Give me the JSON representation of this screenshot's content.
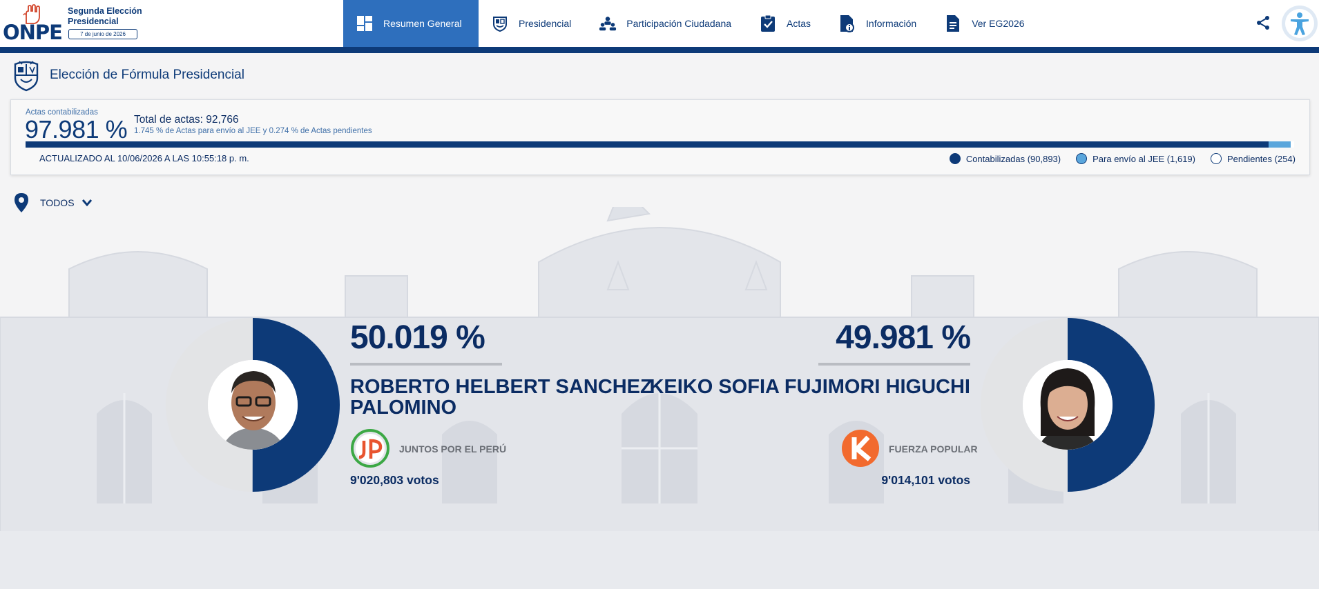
{
  "header": {
    "logo_text": "ONPE",
    "election_title": "Segunda Elección Presidencial",
    "election_date": "7 de junio de 2026",
    "nav": [
      {
        "label": "Resumen General",
        "icon": "dashboard-icon",
        "active": true
      },
      {
        "label": "Presidencial",
        "icon": "shield-emblem-icon",
        "active": false
      },
      {
        "label": "Participación Ciudadana",
        "icon": "people-icon",
        "active": false
      },
      {
        "label": "Actas",
        "icon": "clipboard-check-icon",
        "active": false
      },
      {
        "label": "Información",
        "icon": "document-info-icon",
        "active": false
      },
      {
        "label": "Ver EG2026",
        "icon": "document-icon",
        "active": false
      }
    ]
  },
  "section": {
    "title": "Elección de Fórmula Presidencial"
  },
  "summary": {
    "counted_label": "Actas contabilizadas",
    "counted_pct": "97.981 %",
    "total_label": "Total de actas: 92,766",
    "sub_label": "1.745 % de Actas para envío al JEE y 0.274 % de Actas pendientes",
    "updated": "ACTUALIZADO AL 10/06/2026 A LAS 10:55:18 p. m.",
    "progress": {
      "counted": 97.981,
      "jee": 1.745,
      "pending": 0.274
    },
    "legend": [
      {
        "label": "Contabilizadas (90,893)",
        "color": "#0d3a78"
      },
      {
        "label": "Para envío al JEE (1,619)",
        "color": "#5aa6dc"
      },
      {
        "label": "Pendientes (254)",
        "color": "#ffffff"
      }
    ]
  },
  "filter": {
    "label": "TODOS"
  },
  "candidates": [
    {
      "pct": "50.019 %",
      "name": "ROBERTO HELBERT SANCHEZ PALOMINO",
      "party": "JUNTOS POR EL PERÚ",
      "votes": "9'020,803 votos",
      "share": 50.019
    },
    {
      "pct": "49.981 %",
      "name": "KEIKO SOFIA FUJIMORI HIGUCHI",
      "party": "FUERZA POPULAR",
      "votes": "9'014,101 votos",
      "share": 49.981
    }
  ],
  "colors": {
    "primary": "#0d3a78",
    "active_tab": "#2e6fbd",
    "jee": "#5aa6dc",
    "donut_bg": "#e3e4e6"
  }
}
